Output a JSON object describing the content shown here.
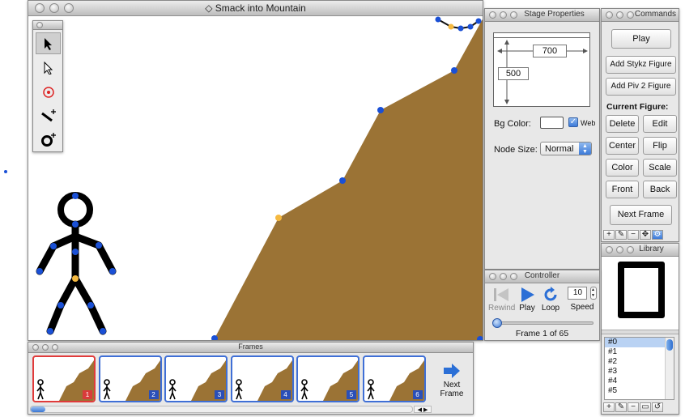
{
  "main_window": {
    "title": "Smack into Mountain"
  },
  "tools": [
    {
      "name": "select-tool-icon"
    },
    {
      "name": "node-select-tool-icon"
    },
    {
      "name": "node-tool-icon"
    },
    {
      "name": "line-add-tool-icon"
    },
    {
      "name": "circle-add-tool-icon"
    }
  ],
  "stage_properties": {
    "title": "Stage Properties",
    "width": "700",
    "height": "500",
    "bg_color_label": "Bg Color:",
    "bg_color": "#ffffff",
    "web_label": "Web",
    "web_checked": true,
    "node_size_label": "Node Size:",
    "node_size_value": "Normal"
  },
  "commands": {
    "title": "Commands",
    "play": "Play",
    "add_stykz": "Add Stykz Figure",
    "add_piv2": "Add Piv 2 Figure",
    "current_figure_label": "Current Figure:",
    "delete": "Delete",
    "edit": "Edit",
    "center": "Center",
    "flip": "Flip",
    "color": "Color",
    "scale": "Scale",
    "front": "Front",
    "back": "Back",
    "next_frame": "Next Frame"
  },
  "controller": {
    "title": "Controller",
    "rewind": "Rewind",
    "play": "Play",
    "loop": "Loop",
    "speed_label": "Speed",
    "speed_value": "10",
    "frame_status": "Frame 1 of 65",
    "progress_fraction": 0.0
  },
  "library": {
    "title": "Library",
    "items": [
      "#0",
      "#1",
      "#2",
      "#3",
      "#4",
      "#5"
    ],
    "selected_index": 0
  },
  "frames": {
    "title": "Frames",
    "items": [
      "1",
      "2",
      "3",
      "4",
      "5",
      "6"
    ],
    "selected_index": 0,
    "next_frame_line1": "Next",
    "next_frame_line2": "Frame"
  },
  "colors": {
    "mountain": "#9b7335",
    "node_blue": "#1a50d6",
    "node_orange": "#f5b940",
    "selected_frame": "#e03b3b",
    "frame_border": "#3f6fd6"
  }
}
